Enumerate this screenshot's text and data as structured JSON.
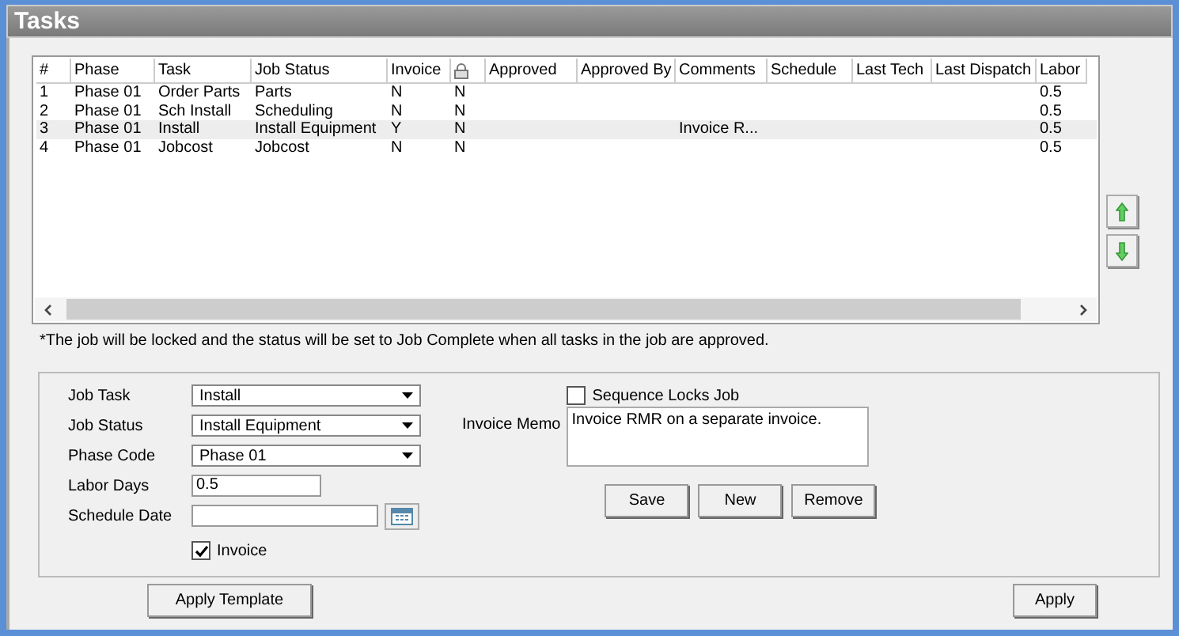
{
  "window": {
    "title": "Tasks"
  },
  "table": {
    "columns": [
      {
        "kind": "text",
        "label": "#"
      },
      {
        "kind": "text",
        "label": "Phase"
      },
      {
        "kind": "text",
        "label": "Task"
      },
      {
        "kind": "text",
        "label": "Job Status"
      },
      {
        "kind": "text",
        "label": "Invoice"
      },
      {
        "kind": "lock"
      },
      {
        "kind": "text",
        "label": "Approved"
      },
      {
        "kind": "text",
        "label": "Approved By"
      },
      {
        "kind": "text",
        "label": "Comments"
      },
      {
        "kind": "text",
        "label": "Schedule"
      },
      {
        "kind": "text",
        "label": "Last Tech"
      },
      {
        "kind": "text",
        "label": "Last Dispatch"
      },
      {
        "kind": "text",
        "label": "Labor"
      }
    ],
    "rows": [
      {
        "selected": false,
        "cells": [
          "1",
          "Phase 01",
          "Order Parts",
          "Parts",
          "N",
          "N",
          null,
          null,
          null,
          null,
          null,
          null,
          "0.5"
        ]
      },
      {
        "selected": false,
        "cells": [
          "2",
          "Phase 01",
          "Sch Install",
          "Scheduling",
          "N",
          "N",
          null,
          null,
          null,
          null,
          null,
          null,
          "0.5"
        ]
      },
      {
        "selected": true,
        "cells": [
          "3",
          "Phase 01",
          "Install",
          "Install Equipment",
          "Y",
          "N",
          null,
          null,
          "Invoice R...",
          null,
          null,
          null,
          "0.5"
        ]
      },
      {
        "selected": false,
        "cells": [
          "4",
          "Phase 01",
          "Jobcost",
          "Jobcost",
          "N",
          "N",
          null,
          null,
          null,
          null,
          null,
          null,
          "0.5"
        ]
      }
    ]
  },
  "note": "*The job will be locked and the status will be set to Job Complete when all tasks in the job are approved.",
  "form": {
    "fields": [
      {
        "kind": "dropdown",
        "label": "Job Task",
        "value": "Install"
      },
      {
        "kind": "dropdown",
        "label": "Job Status",
        "value": "Install Equipment"
      },
      {
        "kind": "dropdown",
        "label": "Phase Code",
        "value": "Phase 01"
      },
      {
        "kind": "text",
        "label": "Labor Days",
        "value": "0.5"
      },
      {
        "kind": "date",
        "label": "Schedule Date"
      }
    ],
    "invoice": {
      "label": "Invoice",
      "checked": true
    },
    "sequence_locks_job": {
      "label": "Sequence Locks Job",
      "checked": false
    },
    "invoice_memo": {
      "label": "Invoice Memo",
      "value": "Invoice RMR on a separate invoice."
    },
    "buttons": [
      "Save",
      "New",
      "Remove"
    ]
  },
  "footer_buttons": [
    "Apply Template",
    "Apply"
  ]
}
